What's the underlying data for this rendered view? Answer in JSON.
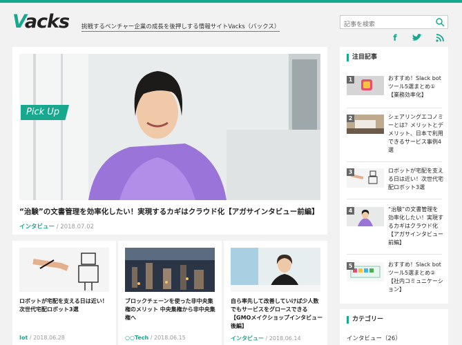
{
  "header": {
    "logo_main": "acks",
    "logo_v": "V",
    "tagline": "挑戦するベンチャー企業の成長を後押しする情報サイトVacks（バックス）",
    "search_placeholder": "記事を検索",
    "social": {
      "facebook": "f",
      "twitter": "t",
      "rss": "rss"
    }
  },
  "pickup": {
    "label": "Pick Up",
    "title": "“治験”の文書管理を効率化したい！実現するカギはクラウド化【アガサインタビュー前編】",
    "category": "インタビュー",
    "date": "/ 2018.07.02"
  },
  "cards": [
    {
      "title": "ロボットが宅配を支える日は近い！次世代宅配ロボット3選",
      "category": "Iot",
      "date": "/ 2018.06.28"
    },
    {
      "title": "ブロックチェーンを使った非中央集権のメリット 中央集権から非中央集権へ",
      "category": "○○Tech",
      "date": "/ 2018.06.15"
    },
    {
      "title": "自ら率先して改善していけば少人数でもサービスをグロースできる【GMOメイクショップインタビュー後編】",
      "category": "インタビュー",
      "date": "/ 2018.06.14"
    }
  ],
  "sidebar": {
    "popular_heading": "注目記事",
    "popular": [
      {
        "rank": "1",
        "title": "おすすめ！Slack botツール5選まとめ①【業務効率化】"
      },
      {
        "rank": "2",
        "title": "シェアリングエコノミーとは？メリットとデメリット、日本で利用できるサービス事例4選"
      },
      {
        "rank": "3",
        "title": "ロボットが宅配を支える日は近い！次世代宅配ロボット3選"
      },
      {
        "rank": "4",
        "title": "“治験”の文書管理を効率化したい！実現するカギはクラウド化【アガサインタビュー前編】"
      },
      {
        "rank": "5",
        "title": "おすすめ！Slack botツール5選まとめ②【社内コミュニケーション】"
      }
    ],
    "category_heading": "カテゴリー",
    "categories": [
      {
        "label": "インタビュー（26）"
      }
    ]
  },
  "colors": {
    "accent": "#17a88f"
  }
}
